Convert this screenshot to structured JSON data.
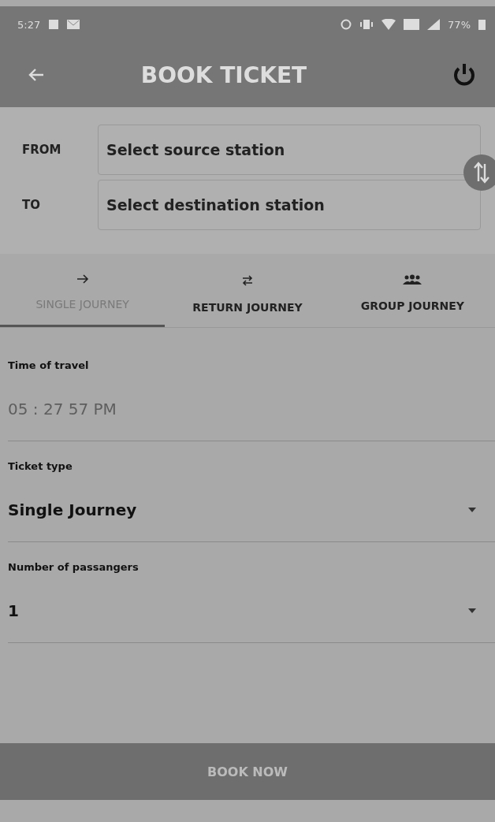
{
  "status_bar": {
    "time": "5:27",
    "battery": "77%"
  },
  "app_bar": {
    "title": "BOOK TICKET"
  },
  "stations": [
    {
      "label": "FROM",
      "placeholder": "Select source station"
    },
    {
      "label": "TO",
      "placeholder": "Select destination station"
    }
  ],
  "tabs": [
    {
      "label": "SINGLE JOURNEY",
      "kind": "arrow",
      "selected": true
    },
    {
      "label": "RETURN JOURNEY",
      "kind": "swap",
      "selected": false
    },
    {
      "label": "GROUP JOURNEY",
      "kind": "group",
      "selected": false
    }
  ],
  "fields": [
    {
      "label": "Time of travel",
      "kind": "time",
      "placeholder": "05 : 27 57 PM"
    },
    {
      "label": "Ticket type",
      "kind": "select",
      "value": "Single Journey"
    },
    {
      "label": "Number of passangers",
      "kind": "select",
      "value": "1"
    }
  ],
  "book_button": "BOOK NOW"
}
